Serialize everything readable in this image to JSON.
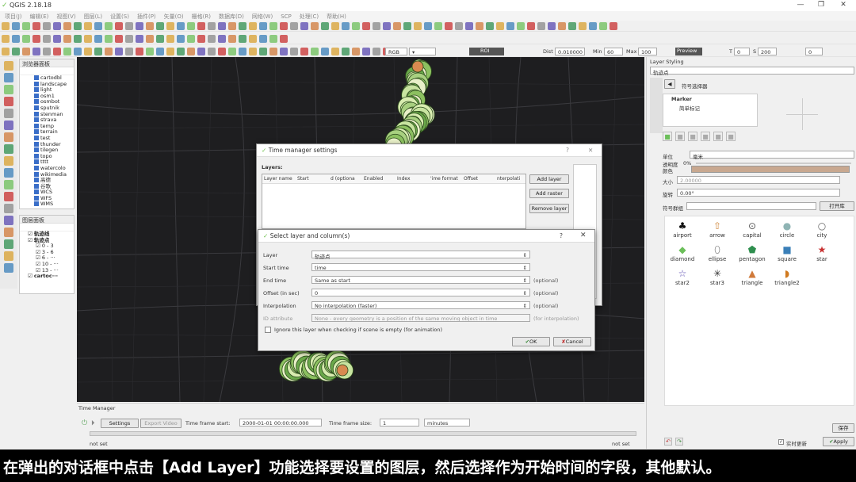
{
  "window": {
    "title": "QGIS 2.18.18"
  },
  "menu": [
    "项目(J)",
    "编辑(E)",
    "视图(V)",
    "图层(L)",
    "设置(S)",
    "插件(P)",
    "矢量(O)",
    "栅格(R)",
    "数据库(D)",
    "网络(W)",
    "SCP",
    "处理(C)",
    "帮助(H)"
  ],
  "toolbar3": {
    "raster_band": "RGB = ",
    "roi_label": "ROI",
    "dist_label": "Dist",
    "dist_value": "0.010000",
    "min_label": "Min",
    "min_value": "60",
    "max_label": "Max",
    "max_value": "100",
    "preview_label": "Preview",
    "t_label": "T",
    "t_value": "0",
    "s_label": "S",
    "s_value": "200",
    "extra_value": "0"
  },
  "browser_panel": {
    "title": "浏览器面板",
    "items": [
      "cartodbl",
      "landscape",
      "light",
      "osm1",
      "osmbot",
      "sputnik",
      "stenman",
      "strava",
      "temp",
      "terrain",
      "test",
      "thunder",
      "tilegen",
      "topo",
      "tttt",
      "watercolo",
      "wikimedia",
      "高德",
      "谷歌",
      "WCS",
      "WFS",
      "WMS"
    ]
  },
  "layers_panel": {
    "title": "图层面板",
    "items": [
      "轨迹线",
      "轨迹点",
      "0 - 3",
      "3 - 6",
      "6 - ···",
      "10 - ···",
      "13 - ···",
      "cartoc···"
    ]
  },
  "time_manager_settings": {
    "title": "Time manager settings",
    "layers_label": "Layers:",
    "columns": [
      "Layer name",
      "Start",
      "d (optiona",
      "Enabled",
      "Index",
      "'ime format",
      "Offset",
      "nterpolati"
    ],
    "add_layer": "Add layer",
    "add_raster": "Add raster",
    "remove_layer": "Remove layer"
  },
  "select_layer": {
    "title": "Select layer and column(s)",
    "help": "?",
    "layer_label": "Layer",
    "layer_value": "轨迹点",
    "start_label": "Start time",
    "start_value": "time",
    "end_label": "End time",
    "end_value": "Same as start",
    "end_opt": "(optional)",
    "offset_label": "Offset (in sec)",
    "offset_value": "0",
    "offset_opt": "(optional)",
    "interp_label": "Interpolation",
    "interp_value": "No interpolation (faster)",
    "interp_opt": "(optional)",
    "id_label": "ID attribute",
    "id_value": "None - every geometry is a position of the same moving object in time",
    "id_opt": "(for interpolation)",
    "ignore_label": "Ignore this layer when checking if scene is empty (for animation)",
    "ok": "OK",
    "cancel": "Cancel"
  },
  "time_manager": {
    "title": "Time Manager",
    "settings": "Settings",
    "export_video": "Export Video",
    "start_label": "Time frame start:",
    "start_value": "2000-01-01 00:00:00.000",
    "size_label": "Time frame size:",
    "size_value": "1",
    "unit_value": "minutes",
    "not_set_left": "not set",
    "not_set_right": "not set"
  },
  "layer_styling": {
    "title": "Layer Styling",
    "layer": "轨迹点",
    "selector_title": "符号选择器",
    "tree_marker": "Marker",
    "tree_simple": "简单标记",
    "unit_label": "单位",
    "unit_value": "毫米",
    "opacity_label": "透明度",
    "opacity_value": "0%",
    "color_label": "颜色",
    "color_value": "#c8a890",
    "size_label": "大小",
    "size_value": "2.00000",
    "rotation_label": "旋转",
    "rotation_value": "0.00°",
    "group_label": "符号群组",
    "open_lib": "打开库",
    "symbols": [
      {
        "name": "airport",
        "glyph": "♣",
        "color": "#111"
      },
      {
        "name": "arrow",
        "glyph": "⇧",
        "color": "#d08a40"
      },
      {
        "name": "capital",
        "glyph": "⊙",
        "color": "#555"
      },
      {
        "name": "circle",
        "glyph": "●",
        "color": "#8fb4b4"
      },
      {
        "name": "city",
        "glyph": "○",
        "color": "#666"
      },
      {
        "name": "diamond",
        "glyph": "◆",
        "color": "#6cbf5a"
      },
      {
        "name": "ellipse",
        "glyph": "⬯",
        "color": "#666"
      },
      {
        "name": "pentagon",
        "glyph": "⬟",
        "color": "#2f8f4f"
      },
      {
        "name": "square",
        "glyph": "■",
        "color": "#3a7fb8"
      },
      {
        "name": "star",
        "glyph": "★",
        "color": "#c83030"
      },
      {
        "name": "star2",
        "glyph": "☆",
        "color": "#5a4ab0"
      },
      {
        "name": "star3",
        "glyph": "✳",
        "color": "#333"
      },
      {
        "name": "triangle",
        "glyph": "▲",
        "color": "#d07a3a"
      },
      {
        "name": "triangle2",
        "glyph": "◗",
        "color": "#d07a20"
      }
    ],
    "save": "保存",
    "live_update": "实时更新",
    "apply": "Apply"
  },
  "caption": "在弹出的对话框中点击【Add Layer】功能选择要设置的图层，然后选择作为开始时间的字段，其他默认。"
}
